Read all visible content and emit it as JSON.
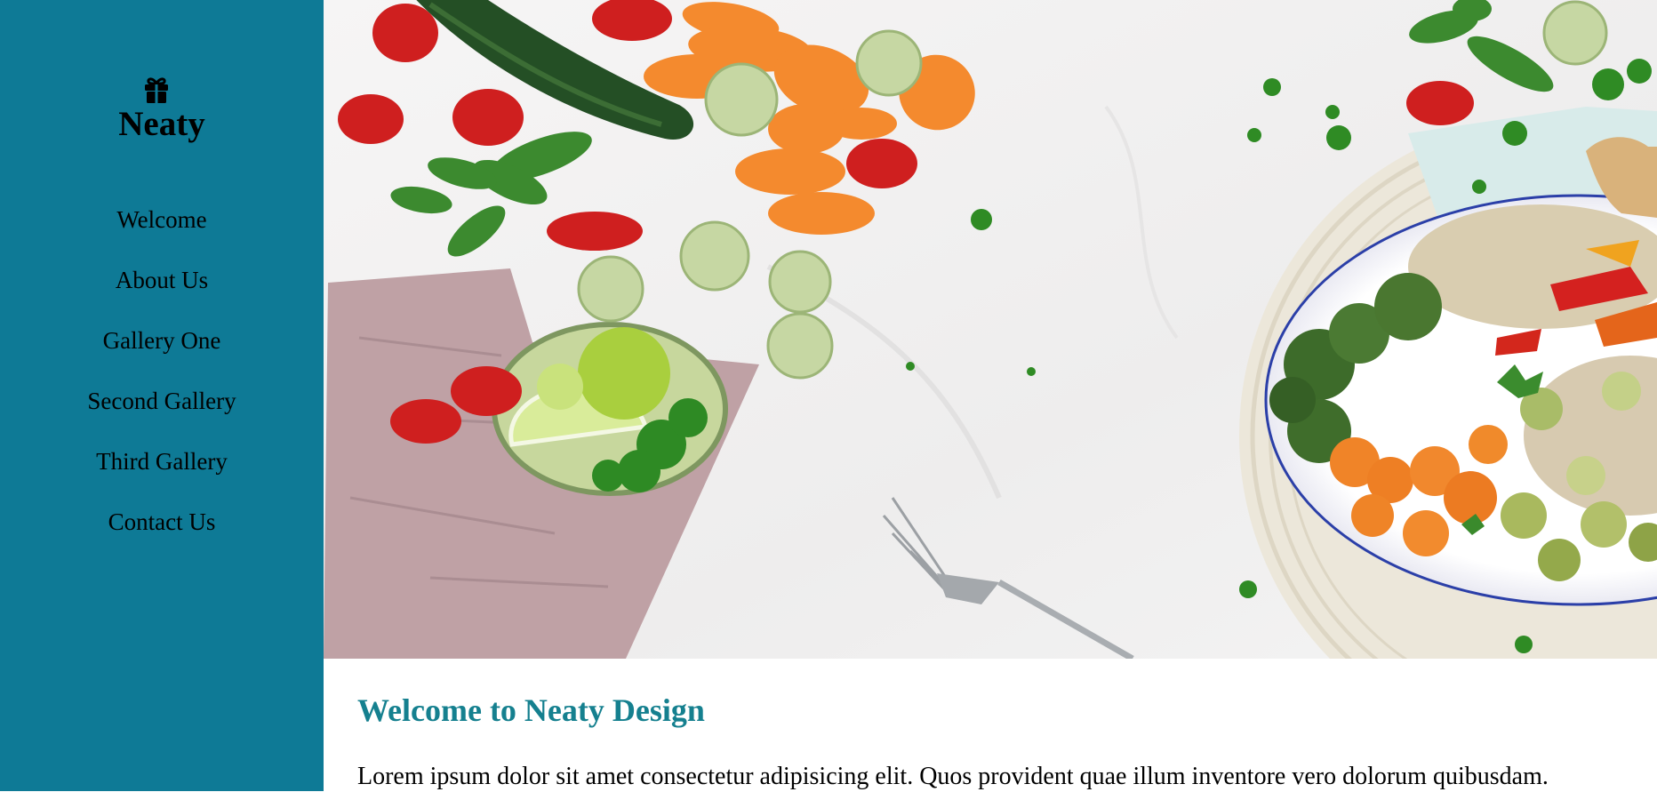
{
  "brand": {
    "name": "Neaty",
    "icon": "gift-icon"
  },
  "nav": {
    "items": [
      {
        "label": "Welcome"
      },
      {
        "label": "About Us"
      },
      {
        "label": "Gallery One"
      },
      {
        "label": "Second Gallery"
      },
      {
        "label": "Third Gallery"
      },
      {
        "label": "Contact Us"
      }
    ]
  },
  "main": {
    "title": "Welcome to Neaty Design",
    "paragraph": "Lorem ipsum dolor sit amet consectetur adipisicing elit. Quos provident quae illum inventore vero dolorum quibusdam."
  },
  "colors": {
    "sidebar": "#0e7a96",
    "title": "#15808f"
  }
}
